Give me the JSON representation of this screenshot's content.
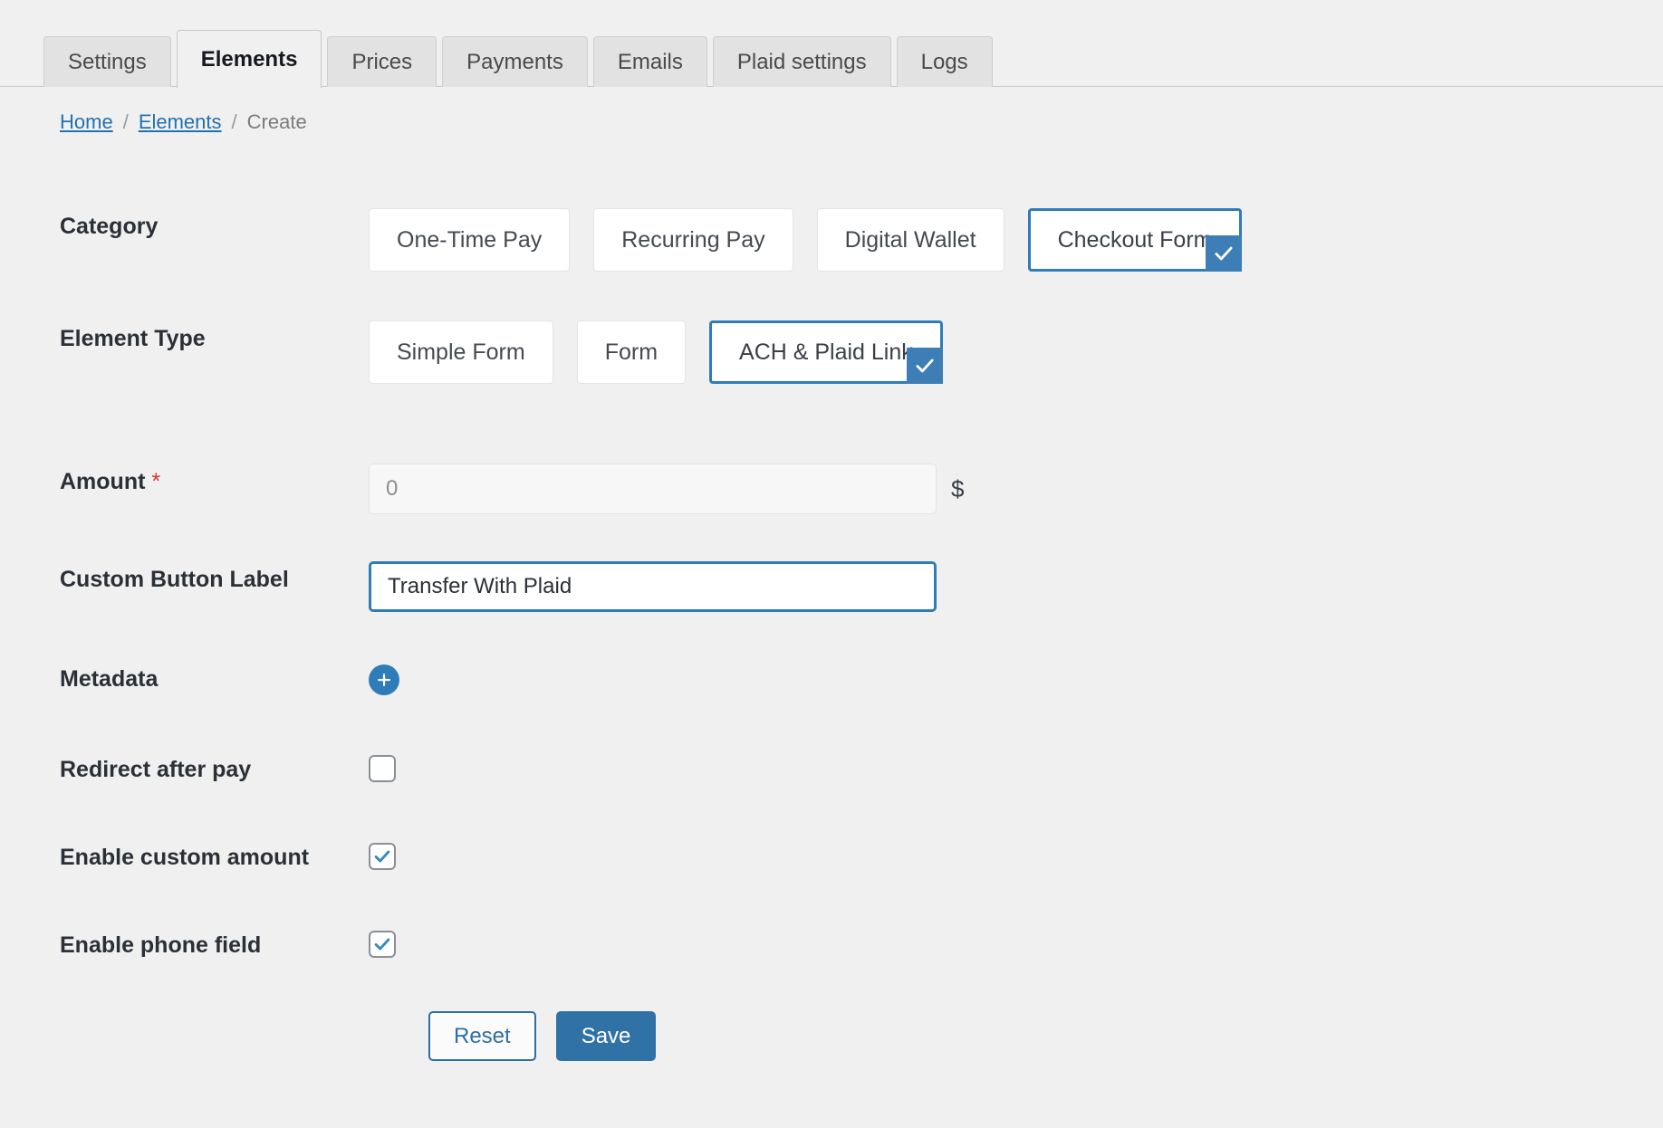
{
  "tabs": [
    {
      "label": "Settings",
      "active": false
    },
    {
      "label": "Elements",
      "active": true
    },
    {
      "label": "Prices",
      "active": false
    },
    {
      "label": "Payments",
      "active": false
    },
    {
      "label": "Emails",
      "active": false
    },
    {
      "label": "Plaid settings",
      "active": false
    },
    {
      "label": "Logs",
      "active": false
    }
  ],
  "breadcrumb": {
    "home": "Home",
    "separator1": "/",
    "section": "Elements",
    "separator2": "/",
    "current": "Create"
  },
  "form": {
    "category": {
      "label": "Category",
      "options": [
        "One-Time Pay",
        "Recurring Pay",
        "Digital Wallet",
        "Checkout Form"
      ],
      "selected": "Checkout Form"
    },
    "element_type": {
      "label": "Element Type",
      "options": [
        "Simple Form",
        "Form",
        "ACH & Plaid Link"
      ],
      "selected": "ACH & Plaid Link"
    },
    "amount": {
      "label": "Amount",
      "required_marker": "*",
      "value": "",
      "placeholder": "0",
      "currency_symbol": "$"
    },
    "custom_button_label": {
      "label": "Custom Button Label",
      "value": "Transfer With Plaid",
      "placeholder": ""
    },
    "metadata": {
      "label": "Metadata",
      "add_icon": "plus-icon"
    },
    "redirect_after_pay": {
      "label": "Redirect after pay",
      "checked": false
    },
    "enable_custom_amount": {
      "label": "Enable custom amount",
      "checked": true
    },
    "enable_phone_field": {
      "label": "Enable phone field",
      "checked": true
    }
  },
  "actions": {
    "reset": "Reset",
    "save": "Save"
  },
  "colors": {
    "accent": "#2e7cb8",
    "save_bg": "#3172a6",
    "link": "#2271b1",
    "required": "#e03030",
    "page_bg": "#f0f0f0"
  }
}
